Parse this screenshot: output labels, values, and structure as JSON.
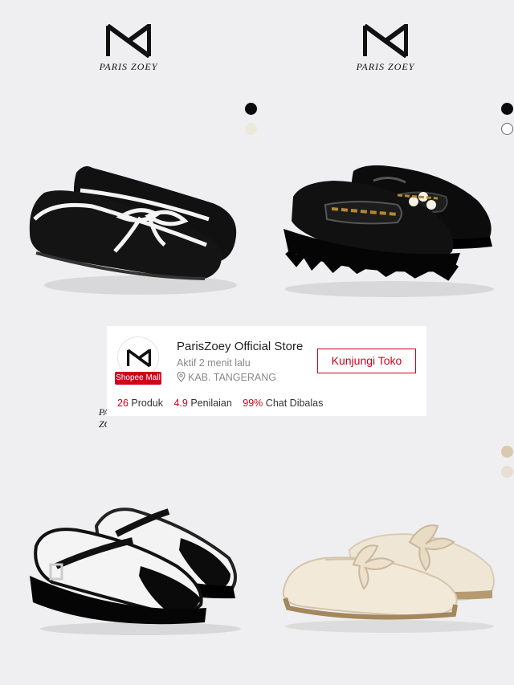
{
  "brand": {
    "name": "PARIS ZOEY"
  },
  "colors": {
    "accent": "#d0011b",
    "background": "#efeff1"
  },
  "color_swatches": {
    "top_left": [
      "black",
      "cream"
    ],
    "top_right": [
      "black",
      "white"
    ],
    "bottom_right": [
      "beige",
      "cream"
    ]
  },
  "products": [
    {
      "icon": "black-ballet-flat-with-white-bow"
    },
    {
      "icon": "black-patent-chunky-loafer-with-pearl-chain"
    },
    {
      "icon": "black-white-mary-jane-platform"
    },
    {
      "icon": "cream-mule-with-bow"
    }
  ],
  "store_card": {
    "badge": "Shopee Mall",
    "name": "ParisZoey Official Store",
    "active_status": "Aktif 2 menit lalu",
    "location": "KAB. TANGERANG",
    "visit_button": "Kunjungi Toko",
    "stats": {
      "products_value": "26",
      "products_label": "Produk",
      "rating_value": "4.9",
      "rating_label": "Penilaian",
      "chat_value": "99%",
      "chat_label": "Chat Dibalas"
    }
  }
}
